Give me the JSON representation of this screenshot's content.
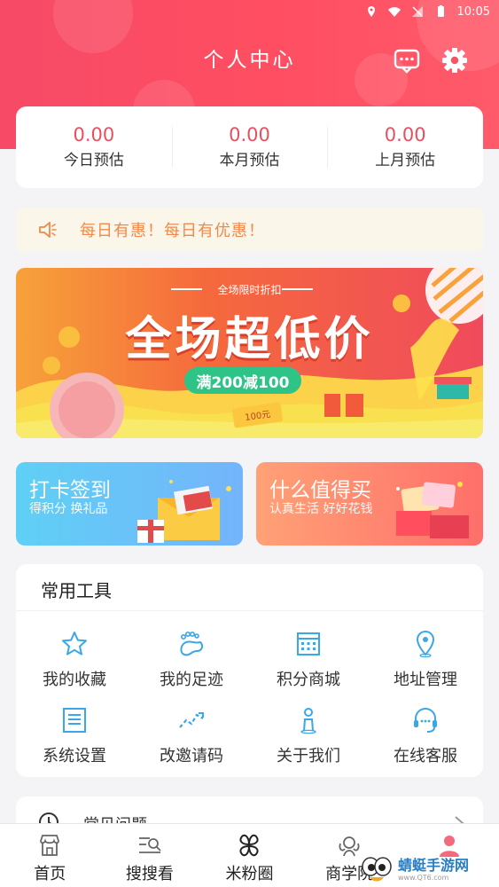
{
  "status_bar": {
    "time": "10:05"
  },
  "header": {
    "title": "个人中心",
    "message_icon": "message-icon",
    "settings_icon": "gear-icon",
    "accent": "#f64a66"
  },
  "stats": [
    {
      "value": "0.00",
      "label": "今日预估"
    },
    {
      "value": "0.00",
      "label": "本月预估"
    },
    {
      "value": "0.00",
      "label": "上月预估"
    }
  ],
  "notice": {
    "icon": "speaker-icon",
    "text": "每日有惠！每日有优惠！"
  },
  "banner": {
    "kicker": "全场限时折扣",
    "headline": "全场超低价",
    "badge": "满200减100",
    "ticket": "100元"
  },
  "promos": [
    {
      "title": "打卡签到",
      "subtitle": "得积分 换礼品"
    },
    {
      "title": "什么值得买",
      "subtitle": "认真生活 好好花钱"
    }
  ],
  "tools": {
    "title": "常用工具",
    "items": [
      {
        "label": "我的收藏",
        "icon": "star-icon"
      },
      {
        "label": "我的足迹",
        "icon": "footprint-icon"
      },
      {
        "label": "积分商城",
        "icon": "calendar-icon"
      },
      {
        "label": "地址管理",
        "icon": "location-icon"
      },
      {
        "label": "系统设置",
        "icon": "document-icon"
      },
      {
        "label": "改邀请码",
        "icon": "trend-icon"
      },
      {
        "label": "关于我们",
        "icon": "person-icon"
      },
      {
        "label": "在线客服",
        "icon": "headset-icon"
      }
    ]
  },
  "faq": {
    "label": "常见问题"
  },
  "tabbar": [
    {
      "label": "首页",
      "icon": "store-icon"
    },
    {
      "label": "搜搜看",
      "icon": "search-list-icon"
    },
    {
      "label": "米粉圈",
      "icon": "clover-icon"
    },
    {
      "label": "商学院",
      "icon": "academy-icon"
    },
    {
      "label": "",
      "icon": "user-icon"
    }
  ],
  "watermark": {
    "name": "蜻蜓手游网",
    "url": "www.QT6.com"
  }
}
